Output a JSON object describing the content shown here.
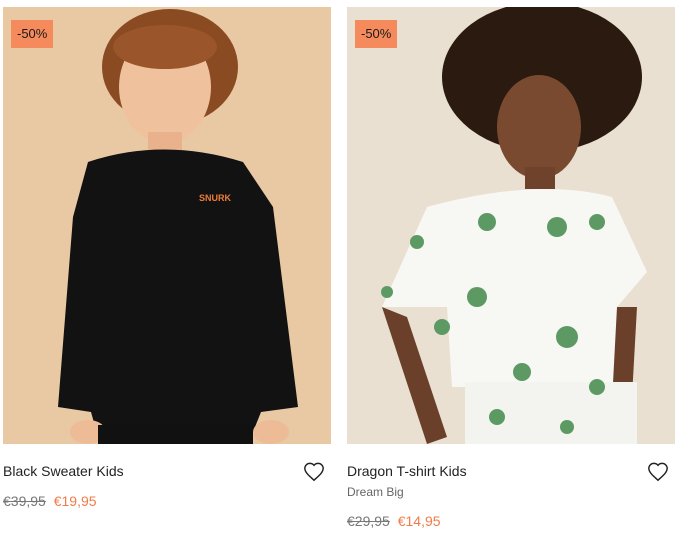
{
  "products": [
    {
      "badge": "-50%",
      "title": "Black Sweater Kids",
      "old_price": "€39,95",
      "new_price": "€19,95",
      "logo_text": "SNURK",
      "favorite_icon": "heart-outline-icon"
    },
    {
      "badge": "-50%",
      "title": "Dragon T-shirt Kids",
      "subtitle": "Dream Big",
      "old_price": "€29,95",
      "new_price": "€14,95",
      "favorite_icon": "heart-outline-icon"
    }
  ],
  "colors": {
    "badge": "#f58a5c",
    "sale_price": "#f07c4a"
  }
}
